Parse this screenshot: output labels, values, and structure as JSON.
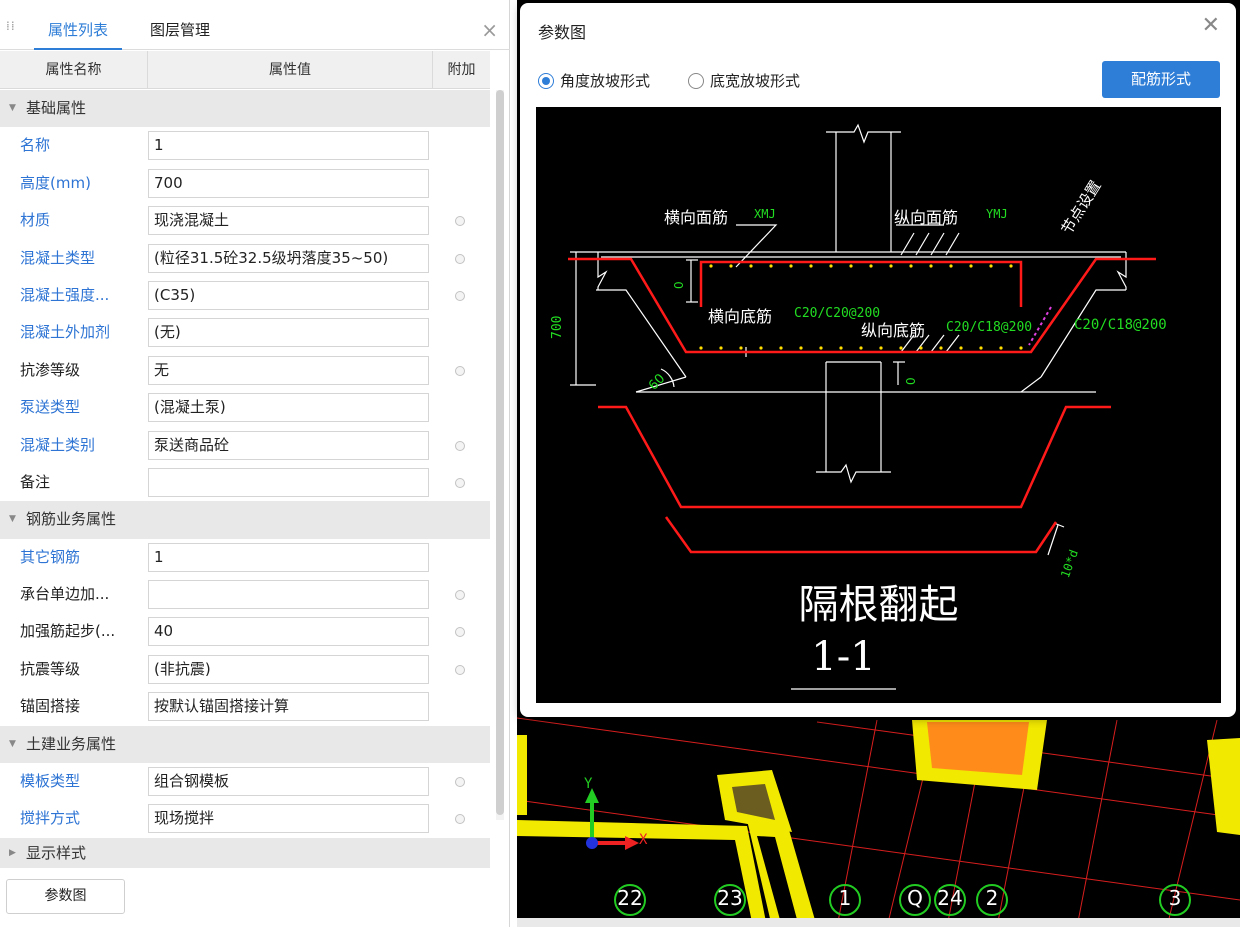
{
  "panel": {
    "tabs": [
      {
        "label": "属性列表",
        "active": true
      },
      {
        "label": "图层管理",
        "active": false
      }
    ],
    "columns": {
      "name": "属性名称",
      "value": "属性值",
      "attach": "附加"
    },
    "rows": [
      {
        "type": "group",
        "label": "基础属性"
      },
      {
        "type": "prop",
        "name": "名称",
        "value": "1",
        "blue": true,
        "attach": false
      },
      {
        "type": "prop",
        "name": "高度(mm)",
        "value": "700",
        "blue": true,
        "attach": false
      },
      {
        "type": "prop",
        "name": "材质",
        "value": "现浇混凝土",
        "blue": true,
        "attach": true
      },
      {
        "type": "prop",
        "name": "混凝土类型",
        "value": "(粒径31.5砼32.5级坍落度35~50)",
        "blue": true,
        "attach": true
      },
      {
        "type": "prop",
        "name": "混凝土强度...",
        "value": "(C35)",
        "blue": true,
        "attach": true
      },
      {
        "type": "prop",
        "name": "混凝土外加剂",
        "value": "(无)",
        "blue": true,
        "attach": false
      },
      {
        "type": "prop",
        "name": "抗渗等级",
        "value": "无",
        "blue": false,
        "attach": true
      },
      {
        "type": "prop",
        "name": "泵送类型",
        "value": "(混凝土泵)",
        "blue": true,
        "attach": false
      },
      {
        "type": "prop",
        "name": "混凝土类别",
        "value": "泵送商品砼",
        "blue": true,
        "attach": true
      },
      {
        "type": "prop",
        "name": "备注",
        "value": "",
        "blue": false,
        "attach": true
      },
      {
        "type": "group",
        "label": "钢筋业务属性"
      },
      {
        "type": "prop",
        "name": "其它钢筋",
        "value": "1",
        "blue": true,
        "attach": false
      },
      {
        "type": "prop",
        "name": "承台单边加...",
        "value": "",
        "blue": false,
        "attach": true
      },
      {
        "type": "prop",
        "name": "加强筋起步(...",
        "value": "40",
        "blue": false,
        "attach": true
      },
      {
        "type": "prop",
        "name": "抗震等级",
        "value": "(非抗震)",
        "blue": false,
        "attach": true
      },
      {
        "type": "prop",
        "name": "锚固搭接",
        "value": "按默认锚固搭接计算",
        "blue": false,
        "attach": false
      },
      {
        "type": "group",
        "label": "土建业务属性"
      },
      {
        "type": "prop",
        "name": "模板类型",
        "value": "组合钢模板",
        "blue": true,
        "attach": true
      },
      {
        "type": "prop",
        "name": "搅拌方式",
        "value": "现场搅拌",
        "blue": true,
        "attach": true
      },
      {
        "type": "group",
        "label": "显示样式",
        "collapsed": true
      }
    ],
    "bottom_button": "参数图"
  },
  "dialog": {
    "title": "参数图",
    "radio_options": [
      {
        "label": "角度放坡形式",
        "selected": true
      },
      {
        "label": "底宽放坡形式",
        "selected": false
      }
    ],
    "button": "配筋形式",
    "drawing": {
      "label_top_transverse": "横向面筋",
      "code_top_transverse": "XMJ",
      "label_top_longitudinal": "纵向面筋",
      "code_top_longitudinal": "YMJ",
      "label_node": "节点设置",
      "label_bottom_transverse": "横向底筋",
      "value_bottom_transverse": "C20/C20@200",
      "label_bottom_longitudinal": "纵向底筋",
      "value_bottom_longitudinal": "C20/C18@200",
      "value_right": "C20/C18@200",
      "dim_height": "700",
      "dim_zero_top": "0",
      "dim_zero_bottom": "0",
      "dim_angle": "60",
      "dim_hook": "10*d",
      "caption": "隔根翻起",
      "section": "1-1"
    }
  },
  "cad": {
    "axis_y": "Y",
    "axis_x": "X",
    "grid_labels": [
      "22",
      "23",
      "1",
      "Q",
      "24",
      "2",
      "3"
    ]
  },
  "colors": {
    "accent": "#2e7dd7",
    "property_blue": "#2e74d4",
    "rebar_red": "#ff1a1a",
    "cad_yellow": "#f2e900",
    "cad_orange": "#ff8c1a",
    "dim_green": "#22dd22"
  }
}
